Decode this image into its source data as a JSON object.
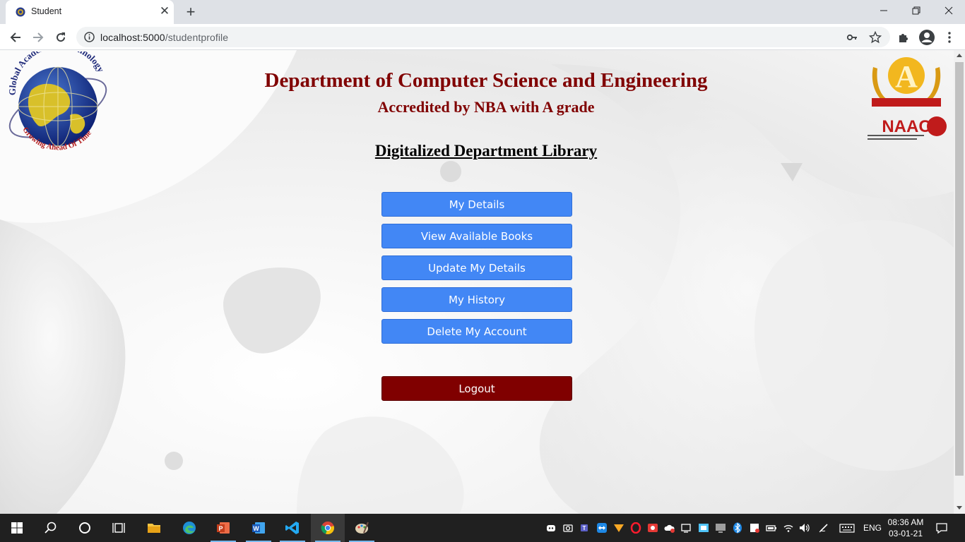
{
  "browser": {
    "tab_title": "Student",
    "url_host": "localhost:5000",
    "url_path": "/studentprofile"
  },
  "page": {
    "department_title": "Department of Computer Science and Engineering",
    "accreditation": "Accredited by NBA with A grade",
    "library_title": "Digitalized Department Library",
    "college_logo_text": "Global Academy of Technology",
    "college_logo_tagline": "Growing Ahead Of Time",
    "naac_logo_letter": "A",
    "naac_logo_text": "NAAC",
    "menu": [
      {
        "label": "My Details"
      },
      {
        "label": "View Available Books"
      },
      {
        "label": "Update My Details"
      },
      {
        "label": "My History"
      },
      {
        "label": "Delete My Account"
      }
    ],
    "logout_label": "Logout",
    "colors": {
      "primary_button": "#4287f5",
      "logout_button": "#800000",
      "heading": "#800000"
    }
  },
  "taskbar": {
    "language": "ENG",
    "time": "08:36 AM",
    "date": "03-01-21",
    "pinned_apps": [
      "file-explorer",
      "edge",
      "powerpoint",
      "word",
      "vscode",
      "chrome",
      "paint"
    ]
  }
}
